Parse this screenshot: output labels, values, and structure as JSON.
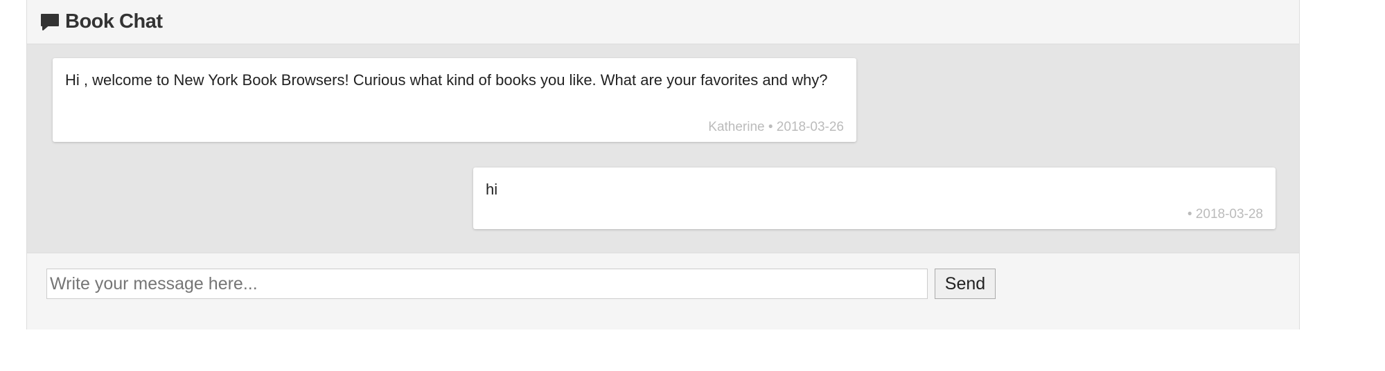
{
  "header": {
    "icon": "comment-icon",
    "title": "Book Chat"
  },
  "messages": [
    {
      "direction": "incoming",
      "text": "Hi , welcome to New York Book Browsers! Curious what kind of books you like. What are your favorites and why?",
      "meta": "Katherine • 2018-03-26"
    },
    {
      "direction": "outgoing",
      "text": "hi",
      "meta": " • 2018-03-28"
    }
  ],
  "composer": {
    "placeholder": "Write your message here...",
    "value": "",
    "send_label": "Send"
  },
  "colors": {
    "panel_bg": "#f5f5f5",
    "messages_bg": "#e5e5e5",
    "bubble_bg": "#ffffff",
    "meta_text": "#bbbbbb"
  }
}
